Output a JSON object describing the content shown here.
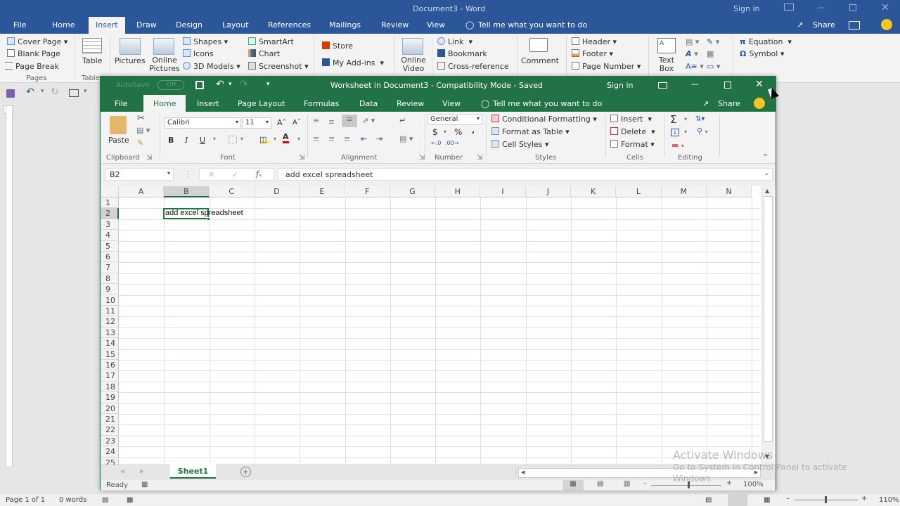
{
  "word": {
    "title": "Document3  -  Word",
    "sign_in": "Sign in",
    "tabs": [
      "File",
      "Home",
      "Insert",
      "Draw",
      "Design",
      "Layout",
      "References",
      "Mailings",
      "Review",
      "View"
    ],
    "active_tab": "Insert",
    "tell_me": "Tell me what you want to do",
    "share": "Share",
    "ribbon": {
      "pages": {
        "items": [
          "Cover Page",
          "Blank Page",
          "Page Break"
        ],
        "label": "Pages"
      },
      "tables": {
        "items": [
          "Table"
        ],
        "label": "Tables"
      },
      "illustrations": {
        "pictures": "Pictures",
        "online_pictures": "Online Pictures",
        "shapes": "Shapes",
        "icons": "Icons",
        "models": "3D Models",
        "smartart": "SmartArt",
        "chart": "Chart",
        "screenshot": "Screenshot"
      },
      "addins": {
        "store": "Store",
        "my_addins": "My Add-ins"
      },
      "media": {
        "online_video": "Online Video"
      },
      "links": {
        "link": "Link",
        "bookmark": "Bookmark",
        "cross_reference": "Cross-reference"
      },
      "comments": {
        "comment": "Comment"
      },
      "header_footer": {
        "header": "Header",
        "footer": "Footer",
        "page_number": "Page Number"
      },
      "text": {
        "text_box": "Text Box"
      },
      "symbols": {
        "equation": "Equation",
        "symbol": "Symbol"
      }
    },
    "status": {
      "page": "Page 1 of 1",
      "words": "0 words",
      "zoom": "110%"
    }
  },
  "excel": {
    "autosave": "AutoSave",
    "autosave_state": "Off",
    "title": "Worksheet in Document3  -  Compatibility Mode  -  Saved",
    "sign_in": "Sign in",
    "tabs": [
      "File",
      "Home",
      "Insert",
      "Page Layout",
      "Formulas",
      "Data",
      "Review",
      "View"
    ],
    "active_tab": "Home",
    "tell_me": "Tell me what you want to do",
    "share": "Share",
    "ribbon": {
      "clipboard": {
        "paste": "Paste",
        "label": "Clipboard"
      },
      "font": {
        "name": "Calibri",
        "size": "11",
        "label": "Font",
        "bold": "B",
        "italic": "I",
        "underline": "U"
      },
      "alignment": {
        "label": "Alignment"
      },
      "number": {
        "format": "General",
        "currency": "$",
        "percent": "%",
        "comma": ",",
        "label": "Number"
      },
      "styles": {
        "conditional": "Conditional Formatting",
        "format_table": "Format as Table",
        "cell_styles": "Cell Styles",
        "label": "Styles"
      },
      "cells": {
        "insert": "Insert",
        "delete": "Delete",
        "format": "Format",
        "label": "Cells"
      },
      "editing": {
        "label": "Editing"
      }
    },
    "name_box": "B2",
    "formula": "add excel spreadsheet",
    "columns": [
      "A",
      "B",
      "C",
      "D",
      "E",
      "F",
      "G",
      "H",
      "I",
      "J",
      "K",
      "L",
      "M",
      "N"
    ],
    "rows": [
      "1",
      "2",
      "3",
      "4",
      "5",
      "6",
      "7",
      "8",
      "9",
      "10",
      "11",
      "12",
      "13",
      "14",
      "15",
      "16",
      "17",
      "18",
      "19",
      "20",
      "21",
      "22",
      "23",
      "24",
      "25"
    ],
    "cell_b2": "add excel spreadsheet",
    "sheet": "Sheet1",
    "status": "Ready",
    "zoom": "100%"
  },
  "watermark": {
    "line1": "Activate Windows",
    "line2": "Go to System in Control Panel to activate",
    "line3": "Windows."
  }
}
